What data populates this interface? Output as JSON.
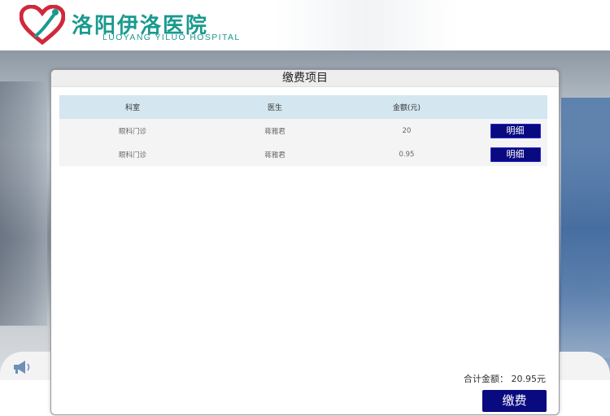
{
  "header": {
    "logo_name_cn": "洛阳伊洛医院",
    "logo_name_en": "LUOYANG YILUO HOSPITAL"
  },
  "panel": {
    "title": "缴费项目",
    "columns": [
      "科室",
      "医生",
      "金额(元)",
      ""
    ],
    "rows": [
      {
        "department": "眼科门诊",
        "doctor": "蒋雅君",
        "amount": "20",
        "action": "明细"
      },
      {
        "department": "眼科门诊",
        "doctor": "蒋雅君",
        "amount": "0.95",
        "action": "明细"
      }
    ],
    "total_label": "合计金额：",
    "total_value": "20.95元",
    "pay_button": "缴费"
  },
  "icons": {
    "logo": "hospital-logo-icon",
    "speaker": "megaphone-icon"
  },
  "colors": {
    "brand_teal": "#1a9a8f",
    "brand_red": "#d0283c",
    "button_navy": "#0a0a80",
    "table_header": "#d4e6ef"
  }
}
